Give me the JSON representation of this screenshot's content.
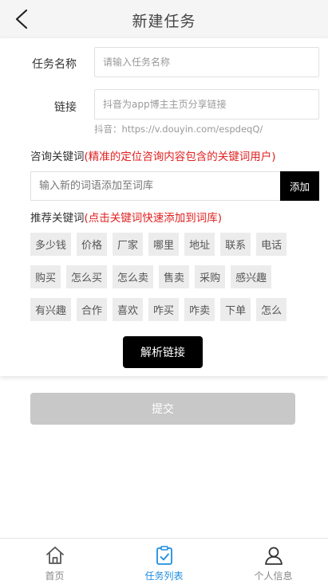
{
  "header": {
    "title": "新建任务"
  },
  "form": {
    "task_name_label": "任务名称",
    "task_name_placeholder": "请输入任务名称",
    "link_label": "链接",
    "link_placeholder": "抖音为app博主主页分享链接",
    "link_hint": "抖音：https://v.douyin.com/espdeqQ/"
  },
  "consult": {
    "title": "咨询关键词",
    "note": "(精准的定位咨询内容包含的关键词用户)",
    "input_placeholder": "输入新的词语添加至词库",
    "add_label": "添加"
  },
  "recommend": {
    "title": "推荐关键词",
    "note": "(点击关键词快速添加到词库)",
    "rows": [
      [
        "多少钱",
        "价格",
        "厂家",
        "哪里",
        "地址",
        "联系",
        "电话"
      ],
      [
        "购买",
        "怎么买",
        "怎么卖",
        "售卖",
        "采购",
        "感兴趣"
      ],
      [
        "有兴趣",
        "合作",
        "喜欢",
        "咋买",
        "咋卖",
        "下单",
        "怎么"
      ]
    ]
  },
  "actions": {
    "parse_label": "解析链接",
    "submit_label": "提交"
  },
  "tabbar": {
    "active": 1,
    "tabs": [
      {
        "label": "首页",
        "icon": "home-icon"
      },
      {
        "label": "任务列表",
        "icon": "clipboard-icon"
      },
      {
        "label": "个人信息",
        "icon": "user-icon"
      }
    ]
  },
  "colors": {
    "accent": "#1f8ee0",
    "note_red": "#e02020",
    "button_black": "#000000",
    "submit_disabled": "#c8c8c8"
  }
}
